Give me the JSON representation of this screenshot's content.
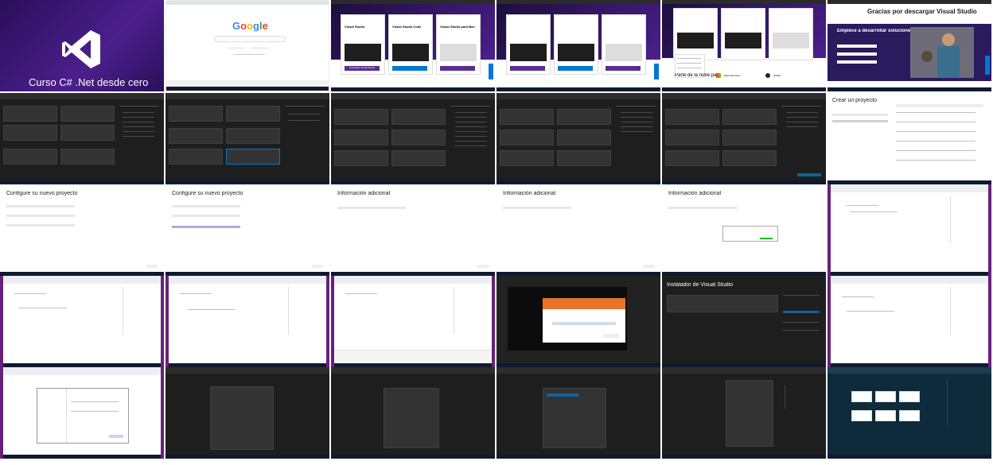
{
  "tiles": {
    "course_title": "Curso C# .Net desde cero",
    "google_logo": "Google",
    "vs_card_titles": [
      "Visual Studio",
      "Visual Studio Code",
      "Visual Studio para Mac"
    ],
    "vs_download_btn": "Descargar Visual Studio",
    "thanks_title": "Gracias por descargar Visual Studio",
    "thanks_subtitle": "Empiece a desarrollar soluciones hoy mismo",
    "create_project_title": "Crear un proyecto",
    "configure_project_title": "Configure su nuevo proyecto",
    "additional_info_title": "Información adicional",
    "installer_title": "Instalador de Visual Studio",
    "parte_label": "Parte de la nube para",
    "microsoft_azure": "Microsoft Azure",
    "github": "GitHub"
  },
  "colors": {
    "vs_purple": "#68217a",
    "dark_bg": "#1e1e1e",
    "taskbar": "#101a2e"
  }
}
